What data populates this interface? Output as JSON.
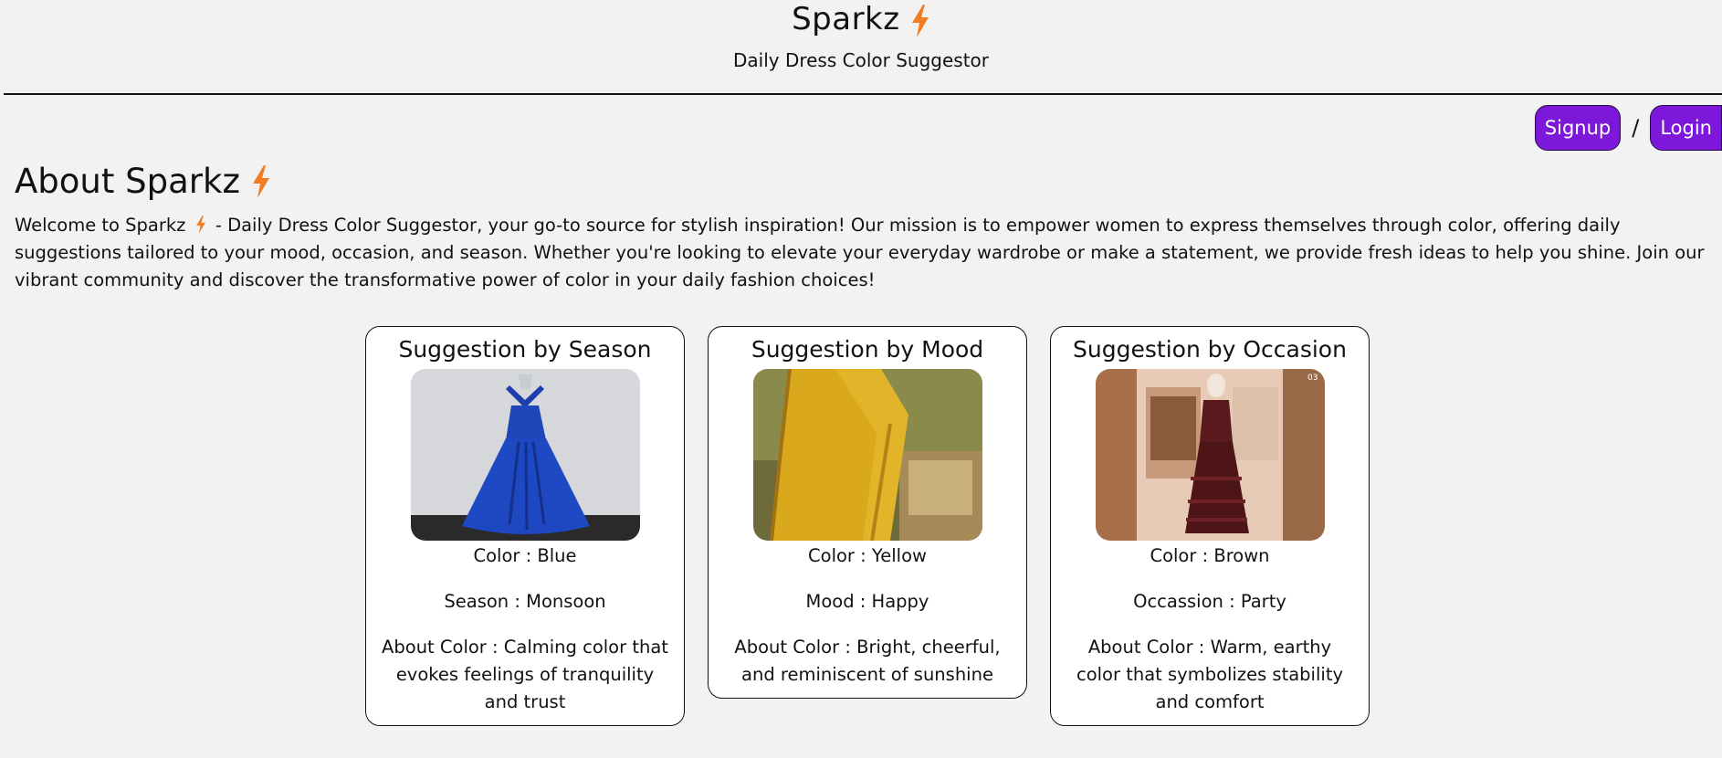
{
  "header": {
    "brand": "Sparkz",
    "tagline": "Daily Dress Color Suggestor"
  },
  "auth": {
    "signup_label": "Signup",
    "separator": "/",
    "login_label": "Login"
  },
  "about": {
    "title": "About Sparkz",
    "text_before": "Welcome to Sparkz",
    "text_after": "- Daily Dress Color Suggestor, your go-to source for stylish inspiration! Our mission is to empower women to express themselves through color, offering daily suggestions tailored to your mood, occasion, and season. Whether you're looking to elevate your everyday wardrobe or make a statement, we provide fresh ideas to help you shine. Join our vibrant community and discover the transformative power of color in your daily fashion choices!"
  },
  "cards": [
    {
      "title": "Suggestion by Season",
      "color_line": "Color : Blue",
      "detail_line": "Season : Monsoon",
      "about_line": "About Color : Calming color that evokes feelings of tranquility and trust"
    },
    {
      "title": "Suggestion by Mood",
      "color_line": "Color : Yellow",
      "detail_line": "Mood : Happy",
      "about_line": "About Color : Bright, cheerful, and reminiscent of sunshine"
    },
    {
      "title": "Suggestion by Occasion",
      "color_line": "Color : Brown",
      "detail_line": "Occassion : Party",
      "about_line": "About Color : Warm, earthy color that symbolizes stability and comfort"
    }
  ],
  "colors": {
    "accent": "#7d17d9",
    "bolt": "#f47c20",
    "background": "#f2f2f2"
  },
  "icons": {
    "bolt": "lightning-bolt-icon"
  }
}
